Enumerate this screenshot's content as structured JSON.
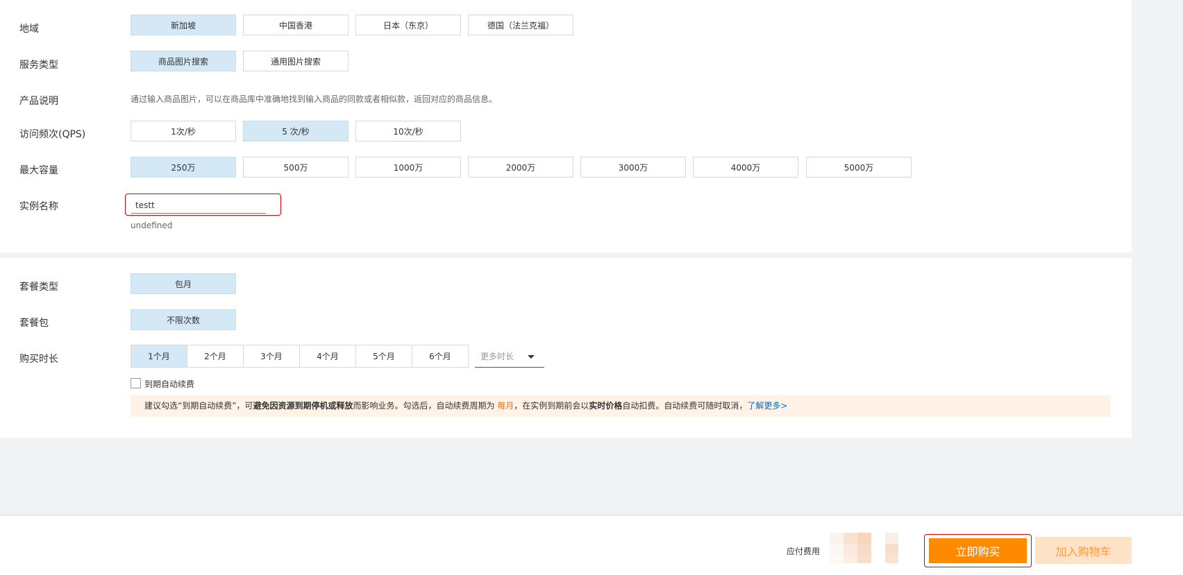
{
  "config": {
    "region": {
      "label": "地域",
      "options": [
        "新加坡",
        "中国香港",
        "日本（东京）",
        "德国（法兰克福）"
      ],
      "selected": "新加坡"
    },
    "service_type": {
      "label": "服务类型",
      "options": [
        "商品图片搜索",
        "通用图片搜索"
      ],
      "selected": "商品图片搜索"
    },
    "product_desc": {
      "label": "产品说明",
      "text": "通过输入商品图片，可以在商品库中准确地找到输入商品的同款或者相似款，返回对应的商品信息。"
    },
    "qps": {
      "label": "访问频次(QPS)",
      "options": [
        "1次/秒",
        "5 次/秒",
        "10次/秒"
      ],
      "selected": "5 次/秒"
    },
    "capacity": {
      "label": "最大容量",
      "options": [
        "250万",
        "500万",
        "1000万",
        "2000万",
        "3000万",
        "4000万",
        "5000万"
      ],
      "selected": "250万"
    },
    "instance_name": {
      "label": "实例名称",
      "value": "testt",
      "hint": "undefined"
    }
  },
  "package": {
    "plan_type": {
      "label": "套餐类型",
      "options": [
        "包月"
      ],
      "selected": "包月"
    },
    "plan_pack": {
      "label": "套餐包",
      "options": [
        "不限次数"
      ],
      "selected": "不限次数"
    },
    "duration": {
      "label": "购买时长",
      "options": [
        "1个月",
        "2个月",
        "3个月",
        "4个月",
        "5个月",
        "6个月"
      ],
      "selected": "1个月",
      "more_label": "更多时长"
    },
    "auto_renew": {
      "label": "到期自动续费",
      "checked": false
    },
    "notice": {
      "p1": "建议勾选“到期自动续费”，可",
      "b1": "避免因资源到期停机或释放",
      "p2": "而影响业务。勾选后，自动续费周期为 ",
      "period": "每月",
      "p3": "，在实例到期前会以",
      "b2": "实时价格",
      "p4": "自动扣费。自动续费可随时取消，",
      "link": "了解更多>"
    }
  },
  "footer": {
    "fee_label": "应付费用",
    "buy_label": "立即购买",
    "cart_label": "加入购物车"
  },
  "colors": {
    "selected_bg": "#d4e8f6",
    "accent_orange": "#ff8a00",
    "cart_bg": "#ffe3c8",
    "link": "#0070cc",
    "highlight_border": "#e00000"
  }
}
